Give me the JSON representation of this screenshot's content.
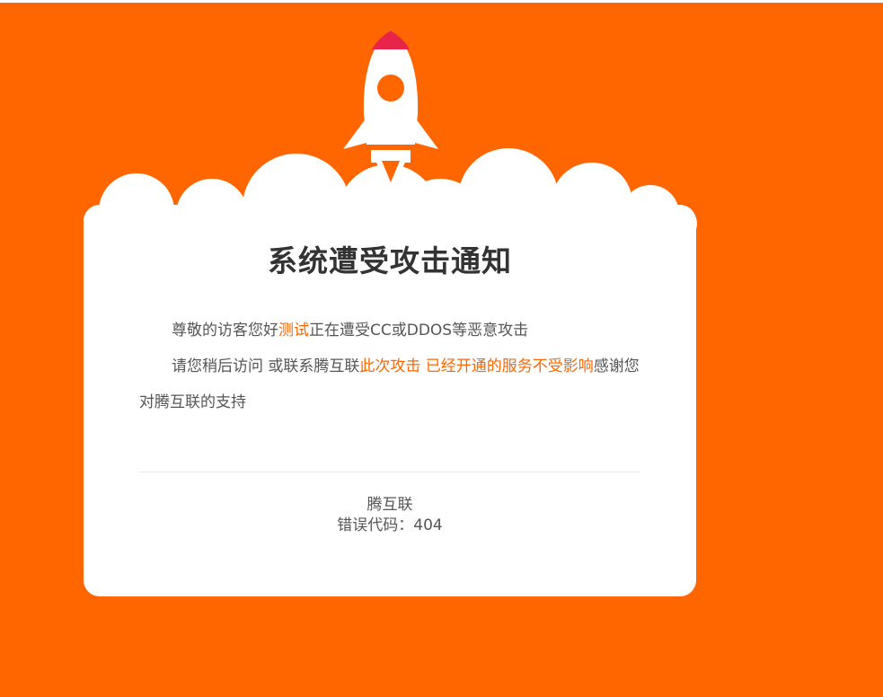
{
  "colors": {
    "background": "#ff6600",
    "card": "#ffffff",
    "accent": "#ff6600",
    "rocket_tip": "#e8244a",
    "text": "#555555",
    "title": "#333333"
  },
  "notice": {
    "title": "系统遭受攻击通知",
    "line1": {
      "prefix": "尊敬的访客您好",
      "site": "测试",
      "suffix": "正在遭受CC或DDOS等恶意攻击"
    },
    "line2": {
      "prefix": "请您稍后访问 或联系腾互联",
      "highlight": "此次攻击 已经开通的服务不受影响",
      "suffix": "感谢您对腾互联的支持"
    }
  },
  "footer": {
    "brand": "腾互联",
    "error_code": "错误代码：404"
  },
  "icons": {
    "hero": "rocket-icon",
    "decoration": "cloud-icon"
  }
}
